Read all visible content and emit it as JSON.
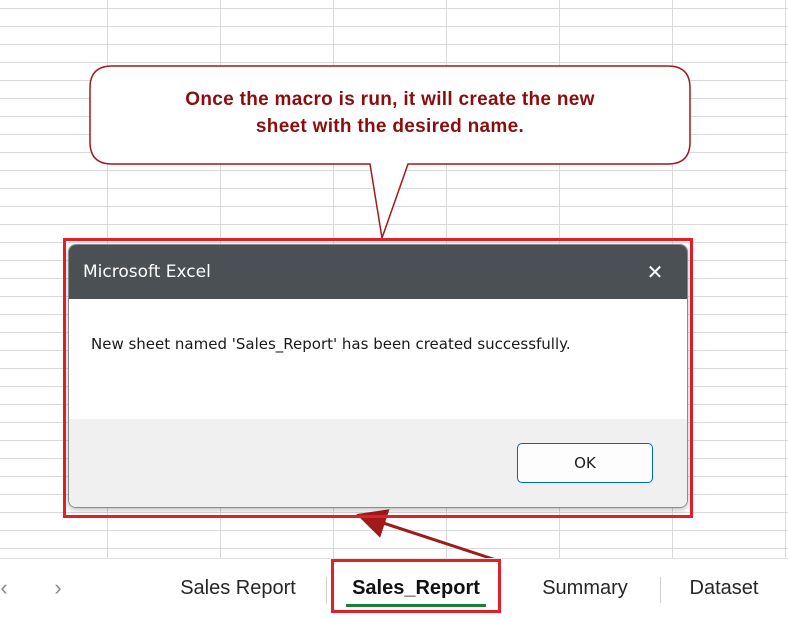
{
  "callout": {
    "text_line1": "Once the macro is run, it will create the new",
    "text_line2": "sheet with the desired name."
  },
  "dialog": {
    "title": "Microsoft Excel",
    "close_glyph": "✕",
    "message": "New sheet named 'Sales_Report' has been created successfully.",
    "ok_label": "OK"
  },
  "tabs": {
    "prev_glyph": "‹",
    "next_glyph": "›",
    "items": [
      {
        "label": "Sales Report",
        "active": false
      },
      {
        "label": "Sales_Report",
        "active": true
      },
      {
        "label": "Summary",
        "active": false
      },
      {
        "label": "Dataset",
        "active": false
      }
    ]
  },
  "colors": {
    "annotation_red": "#e0202a",
    "callout_text": "#8b0e0e",
    "titlebar": "#4a5054",
    "active_tab_underline": "#1b7f3a",
    "ok_border": "#0067c0"
  }
}
